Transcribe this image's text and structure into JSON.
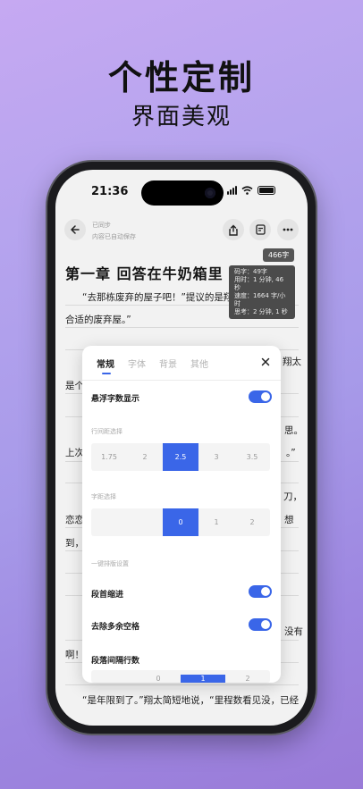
{
  "promo": {
    "headline": "个性定制",
    "subline": "界面美观"
  },
  "status_bar": {
    "time": "21:36"
  },
  "reader_toolbar": {
    "sync_status": "已同步",
    "autosave_status": "内容已自动保存"
  },
  "word_badge": "466字",
  "stats": {
    "typed": "码字：49字",
    "elapsed": "用时：1 分钟, 46 秒",
    "speed": "速度：1664 字/小时",
    "thinking": "思考：2 分钟, 1 秒"
  },
  "chapter": {
    "title": "第一章  回答在牛奶箱里",
    "lines": [
      "“去那栋废弃的屋子吧！”提议的是翔太，“那里",
      "合适的废弃屋。”",
      "翔太",
      "是个",
      "思。",
      "上次",
      "。”",
      "刀，",
      "恋恋",
      "想",
      "到，",
      "没有",
      "啊！",
      "“是年限到了。”翔太简短地说，“里程数看见没，已经"
    ]
  },
  "settings_sheet": {
    "tabs": [
      {
        "label": "常规",
        "active": true
      },
      {
        "label": "字体",
        "active": false
      },
      {
        "label": "背景",
        "active": false
      },
      {
        "label": "其他",
        "active": false
      }
    ],
    "floating_count": {
      "label": "悬浮字数显示",
      "on": true
    },
    "line_spacing": {
      "title": "行间距选择",
      "options": [
        "1.75",
        "2",
        "2.5",
        "3",
        "3.5"
      ],
      "selected": "2.5"
    },
    "letter_spacing": {
      "title": "字距选择",
      "options": [
        "",
        "0",
        "1",
        "2"
      ],
      "selected": "0"
    },
    "one_click_title": "一键排版设置",
    "indent": {
      "label": "段首缩进",
      "on": true
    },
    "trim_spaces": {
      "label": "去除多余空格",
      "on": true
    },
    "para_spacing": {
      "label": "段落间隔行数",
      "options": [
        "",
        "0",
        "1",
        "2"
      ],
      "selected": "1"
    }
  },
  "colors": {
    "accent": "#3a66e8",
    "background": "#b0a0ec"
  }
}
